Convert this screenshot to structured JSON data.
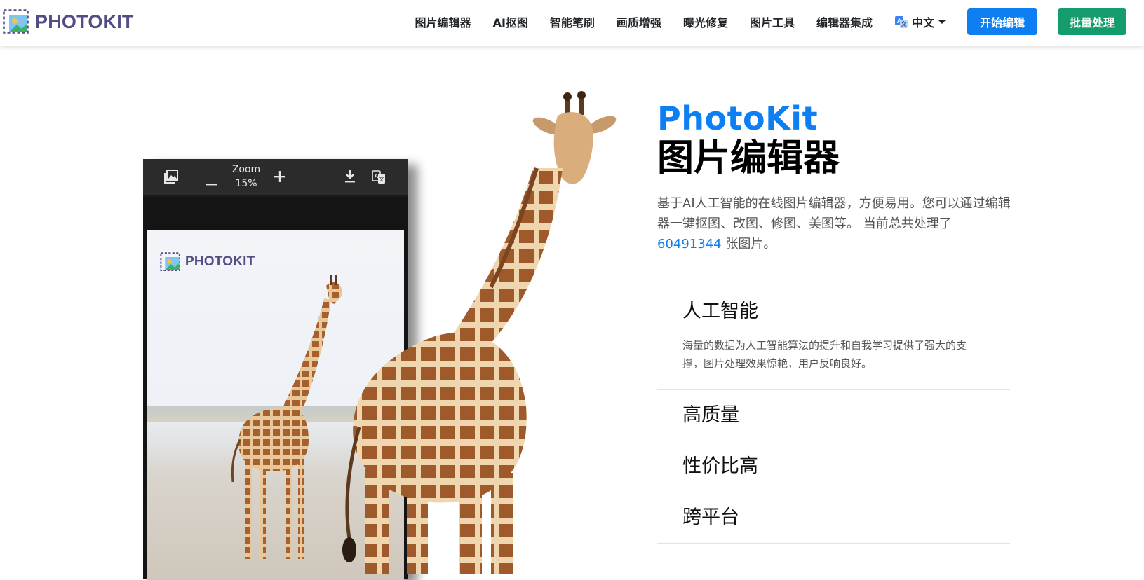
{
  "header": {
    "brand": "PHOTOKIT",
    "nav": [
      "图片编辑器",
      "AI抠图",
      "智能笔刷",
      "画质增强",
      "曝光修复",
      "图片工具",
      "编辑器集成"
    ],
    "language": "中文",
    "start_button": "开始编辑",
    "batch_button": "批量处理"
  },
  "editor": {
    "zoom_label": "Zoom",
    "zoom_value": "15%",
    "inner_brand": "PHOTOKIT"
  },
  "hero": {
    "brand_title": "PhotoKit",
    "page_title": "图片编辑器",
    "desc_text": "基于AI人工智能的在线图片编辑器，方便易用。您可以通过编辑器一键抠图、改图、修图、美图等。 当前总共处理了",
    "count": "60491344",
    "count_suffix": " 张图片。"
  },
  "features": [
    {
      "title": "人工智能",
      "body": "海量的数据为人工智能算法的提升和自我学习提供了强大的支撑，图片处理效果惊艳，用户反响良好。"
    },
    {
      "title": "高质量"
    },
    {
      "title": "性价比高"
    },
    {
      "title": "跨平台"
    }
  ],
  "colors": {
    "primary": "#0d7ff2",
    "success": "#159c6c",
    "brand": "#524d85"
  }
}
